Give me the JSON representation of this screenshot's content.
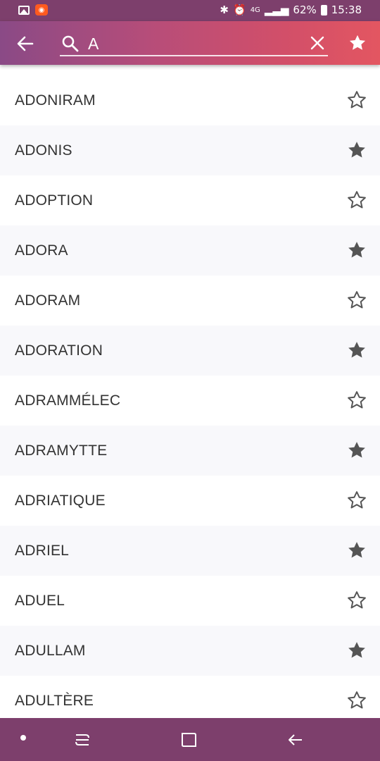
{
  "status_bar": {
    "network": "4G",
    "battery": "62%",
    "time": "15:38",
    "notification_icons": [
      "gallery-icon",
      "app-notification-icon"
    ],
    "system_icons": [
      "bluetooth-icon",
      "alarm-icon",
      "signal-icon",
      "battery-icon"
    ]
  },
  "colors": {
    "status_bar": "#7d3f6c",
    "app_bar_gradient": [
      "#8a4a86",
      "#e35661"
    ],
    "row_alt": "#f8f8fb",
    "star": "#555555"
  },
  "search": {
    "value": "A"
  },
  "words": [
    {
      "label": "ADONIRAM",
      "favorite": false
    },
    {
      "label": "ADONIS",
      "favorite": true
    },
    {
      "label": "ADOPTION",
      "favorite": false
    },
    {
      "label": "ADORA",
      "favorite": true
    },
    {
      "label": "ADORAM",
      "favorite": false
    },
    {
      "label": "ADORATION",
      "favorite": true
    },
    {
      "label": "ADRAMMÉLEC",
      "favorite": false
    },
    {
      "label": "ADRAMYTTE",
      "favorite": true
    },
    {
      "label": "ADRIATIQUE",
      "favorite": false
    },
    {
      "label": "ADRIEL",
      "favorite": true
    },
    {
      "label": "ADUEL",
      "favorite": false
    },
    {
      "label": "ADULLAM",
      "favorite": true
    },
    {
      "label": "ADULTÈRE",
      "favorite": false
    }
  ],
  "nav_bar": {
    "buttons": [
      "dot-icon",
      "recent-apps-icon",
      "home-icon",
      "back-icon"
    ]
  }
}
